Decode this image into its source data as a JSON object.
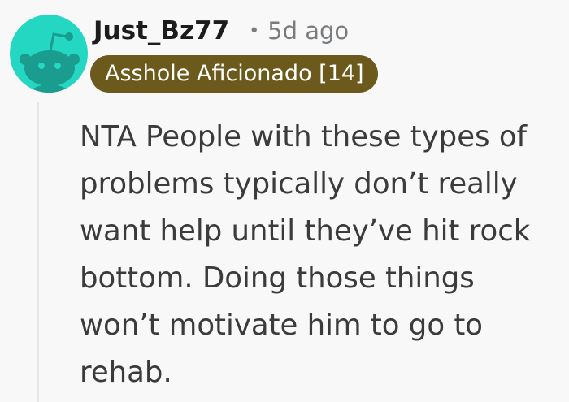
{
  "comment": {
    "username": "Just_Bz77",
    "separator": "•",
    "timestamp": "5d ago",
    "flair": "Asshole Aficionado [14]",
    "body": "NTA People with these types of\nproblems typically don’t really\nwant help until they’ve hit rock\nbottom. Doing those things\nwon’t motivate him to go to\nrehab."
  },
  "colors": {
    "avatar_bg": "#24d7c2",
    "flair_bg": "#6b5a1c",
    "flair_text": "#ffffff",
    "username": "#1c1c1c",
    "meta": "#787c7e",
    "body_text": "#3b3b3b",
    "background": "#f8f8f8"
  },
  "icons": {
    "avatar": "reddit-snoo-avatar-icon"
  }
}
